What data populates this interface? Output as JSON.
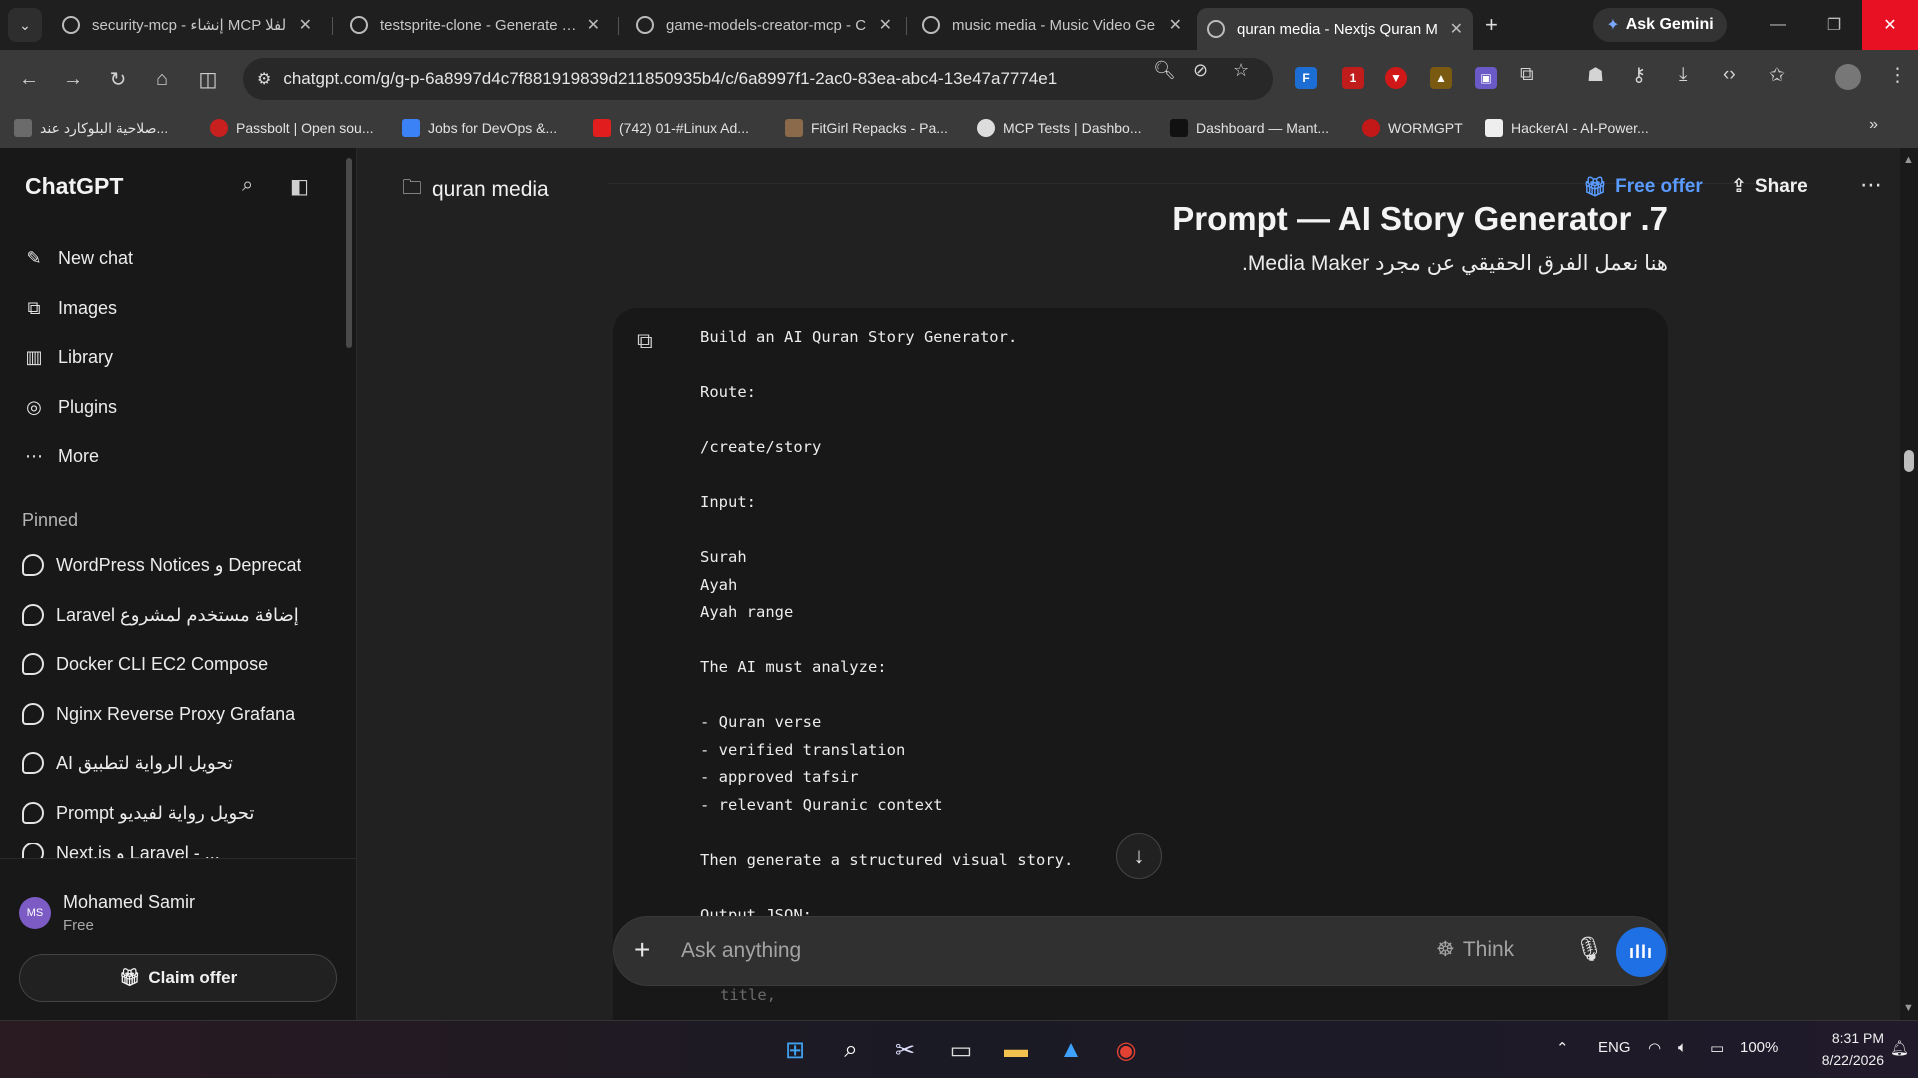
{
  "browser": {
    "tabs": [
      {
        "label": "security-mcp - إنشاء MCP لفلا",
        "active": false
      },
      {
        "label": "testsprite-clone - Generate Te",
        "active": false
      },
      {
        "label": "game-models-creator-mcp - C",
        "active": false
      },
      {
        "label": "music media - Music Video Ge",
        "active": false
      },
      {
        "label": "quran media - Nextjs Quran M",
        "active": true
      }
    ],
    "gemini_label": "Ask Gemini",
    "url": "chatgpt.com/g/g-p-6a8997d4c7f881919839d211850935b4/c/6a8997f1-2ac0-83ea-abc4-13e47a7774e1",
    "bookmarks": [
      "صلاحية البلوكارد عند...",
      "Passbolt | Open sou...",
      "Jobs for DevOps &...",
      "(742) 01-#Linux Ad...",
      "FitGirl Repacks - Pa...",
      "MCP Tests | Dashbo...",
      "Dashboard — Mant...",
      "WORMGPT",
      "HackerAI - AI-Power..."
    ],
    "extension_badge": "1"
  },
  "sidebar": {
    "brand": "ChatGPT",
    "nav": [
      {
        "label": "New chat",
        "icon": "edit-icon"
      },
      {
        "label": "Images",
        "icon": "images-icon"
      },
      {
        "label": "Library",
        "icon": "library-icon"
      },
      {
        "label": "Plugins",
        "icon": "plugins-icon"
      },
      {
        "label": "More",
        "icon": "more-icon"
      }
    ],
    "pinned_heading": "Pinned",
    "pinned": [
      "WordPress Notices و Deprecat",
      "Laravel إضافة مستخدم لمشروع",
      "Docker CLI EC2 Compose",
      "Nginx Reverse Proxy Grafana",
      "AI تحويل الرواية لتطبيق",
      "Prompt تحويل رواية لفيديو",
      "Next.js و Laravel - ..."
    ],
    "user": {
      "initials": "MS",
      "name": "Mohamed Samir",
      "plan": "Free"
    },
    "claim_label": "Claim offer"
  },
  "main": {
    "project_name": "quran media",
    "free_offer": "Free offer",
    "share": "Share",
    "message_title": "Prompt — AI Story Generator .7",
    "message_subtitle": "هنا نعمل الفرق الحقيقي عن مجرد Media Maker.",
    "code_lines": [
      "Build an AI Quran Story Generator.",
      "",
      "Route:",
      "",
      "/create/story",
      "",
      "Input:",
      "",
      "Surah",
      "Ayah",
      "Ayah range",
      "",
      "The AI must analyze:",
      "",
      "- Quran verse",
      "- verified translation",
      "- approved tafsir",
      "- relevant Quranic context",
      "",
      "Then generate a structured visual story.",
      "",
      "Output JSON:"
    ],
    "ghost_code": "title,",
    "composer": {
      "placeholder": "Ask anything",
      "think": "Think"
    }
  },
  "taskbar": {
    "lang": "ENG",
    "battery": "100%",
    "time": "8:31 PM",
    "date": "8/22/2026"
  },
  "colors": {
    "accent_blue": "#1f6fe5",
    "free_offer_blue": "#5a9bff",
    "close_red": "#e81123"
  }
}
